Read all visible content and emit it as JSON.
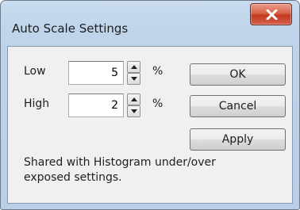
{
  "window": {
    "title": "Auto Scale Settings",
    "close_icon": "close-icon"
  },
  "fields": {
    "low": {
      "label": "Low",
      "value": "5",
      "unit": "%"
    },
    "high": {
      "label": "High",
      "value": "2",
      "unit": "%"
    }
  },
  "buttons": {
    "ok": "OK",
    "cancel": "Cancel",
    "apply": "Apply"
  },
  "note": "Shared with Histogram under/over exposed settings.",
  "colors": {
    "frame": "#bfd3ea",
    "client": "#f0f0f0",
    "close_button": "#c2391f"
  }
}
